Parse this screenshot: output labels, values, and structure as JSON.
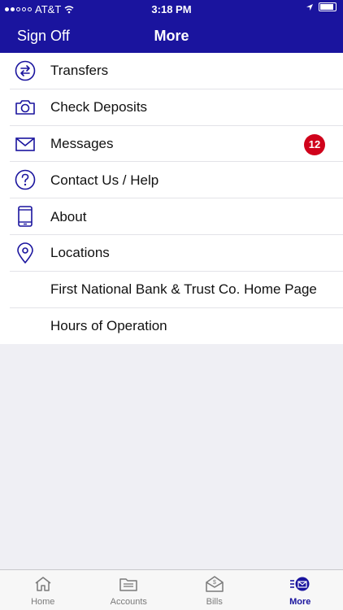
{
  "status_bar": {
    "carrier": "AT&T",
    "time": "3:18 PM"
  },
  "nav": {
    "left_button": "Sign Off",
    "title": "More"
  },
  "menu": {
    "items": [
      {
        "label": "Transfers",
        "icon": "transfer-arrows-icon"
      },
      {
        "label": "Check Deposits",
        "icon": "camera-icon"
      },
      {
        "label": "Messages",
        "icon": "envelope-icon",
        "badge": "12"
      },
      {
        "label": "Contact Us / Help",
        "icon": "question-circle-icon"
      },
      {
        "label": "About",
        "icon": "phone-device-icon"
      },
      {
        "label": "Locations",
        "icon": "location-pin-icon"
      },
      {
        "label": "First National Bank & Trust Co. Home Page"
      },
      {
        "label": "Hours of Operation"
      }
    ]
  },
  "tabs": [
    {
      "label": "Home",
      "icon": "home-icon"
    },
    {
      "label": "Accounts",
      "icon": "accounts-icon"
    },
    {
      "label": "Bills",
      "icon": "bills-icon"
    },
    {
      "label": "More",
      "icon": "more-icon",
      "active": true
    }
  ],
  "colors": {
    "brand": "#1a149e",
    "badge": "#d0021b",
    "icon_stroke": "#1a149e"
  }
}
